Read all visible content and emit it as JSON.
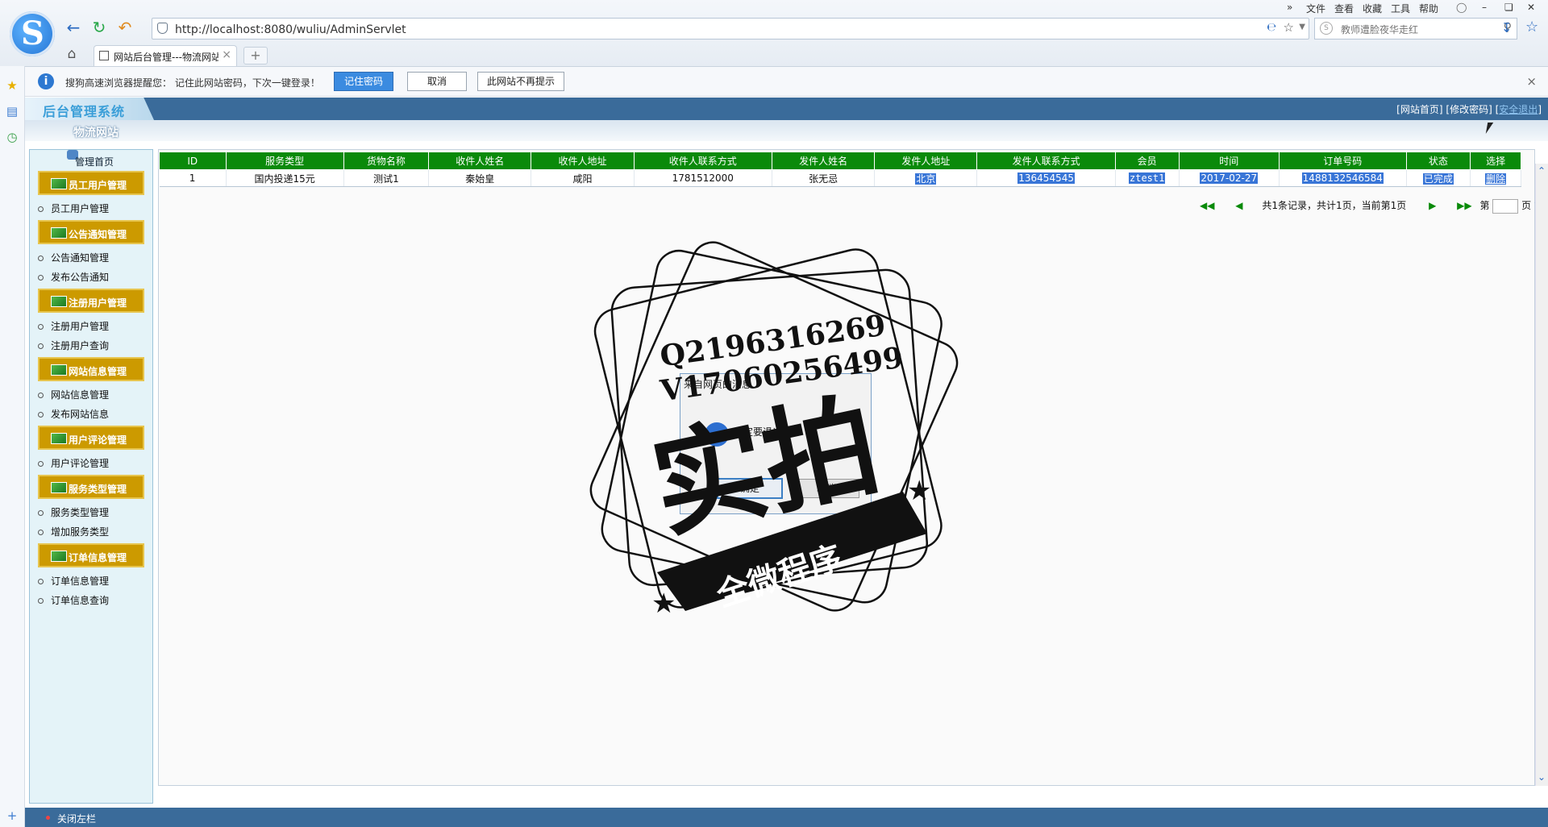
{
  "browser": {
    "address": "http://localhost:8080/wuliu/AdminServlet",
    "search_placeholder": "教师遭脸夜华走红",
    "menu": [
      "文件",
      "查看",
      "收藏",
      "工具",
      "帮助"
    ],
    "tab_label": "网站后台管理---物流网站",
    "newtab": "+"
  },
  "notification": {
    "text": "搜狗高速浏览器提醒您： 记住此网站密码，下次一键登录！",
    "remember": "记住密码",
    "cancel": "取消",
    "never": "此网站不再提示",
    "close": "×"
  },
  "app": {
    "title": "后台管理系统",
    "site_name": "物流网站",
    "links": {
      "home": "网站首页",
      "change_pwd": "修改密码",
      "logout": "安全退出"
    }
  },
  "sidebar": {
    "home": "管理首页",
    "groups": [
      {
        "label": "员工用户管理",
        "items": [
          "员工用户管理"
        ]
      },
      {
        "label": "公告通知管理",
        "items": [
          "公告通知管理",
          "发布公告通知"
        ]
      },
      {
        "label": "注册用户管理",
        "items": [
          "注册用户管理",
          "注册用户查询"
        ]
      },
      {
        "label": "网站信息管理",
        "items": [
          "网站信息管理",
          "发布网站信息"
        ]
      },
      {
        "label": "用户评论管理",
        "items": [
          "用户评论管理"
        ]
      },
      {
        "label": "服务类型管理",
        "items": [
          "服务类型管理",
          "增加服务类型"
        ]
      },
      {
        "label": "订单信息管理",
        "items": [
          "订单信息管理",
          "订单信息查询"
        ]
      }
    ]
  },
  "table": {
    "headers": [
      "ID",
      "服务类型",
      "货物名称",
      "收件人姓名",
      "收件人地址",
      "收件人联系方式",
      "发件人姓名",
      "发件人地址",
      "发件人联系方式",
      "会员",
      "时间",
      "订单号码",
      "状态",
      "选择"
    ],
    "rows": [
      [
        "1",
        "国内投递15元",
        "测试1",
        "秦始皇",
        "咸阳",
        "1781512000",
        "张无忌",
        "北京",
        "136454545",
        "ztest1",
        "2017-02-27",
        "1488132546584",
        "已完成",
        "删除"
      ]
    ]
  },
  "pager": {
    "summary": "共1条记录，共计1页，当前第1页",
    "page_prefix": "第",
    "page_suffix": "页"
  },
  "dialog": {
    "title": "来自网页的消息",
    "message": "确定要退出吗？",
    "ok": "确定",
    "cancel": "取消"
  },
  "watermark": {
    "line1": "Q2196316269",
    "line2": "V17060256499",
    "big": "实拍",
    "ribbon": "全微程序"
  },
  "footer": {
    "text": "关闭左栏"
  },
  "colors": {
    "header_bg": "#3a6b9a",
    "table_header": "#0a8a0a",
    "sidebar_group": "#cc9a00",
    "selection": "#3875d7"
  }
}
